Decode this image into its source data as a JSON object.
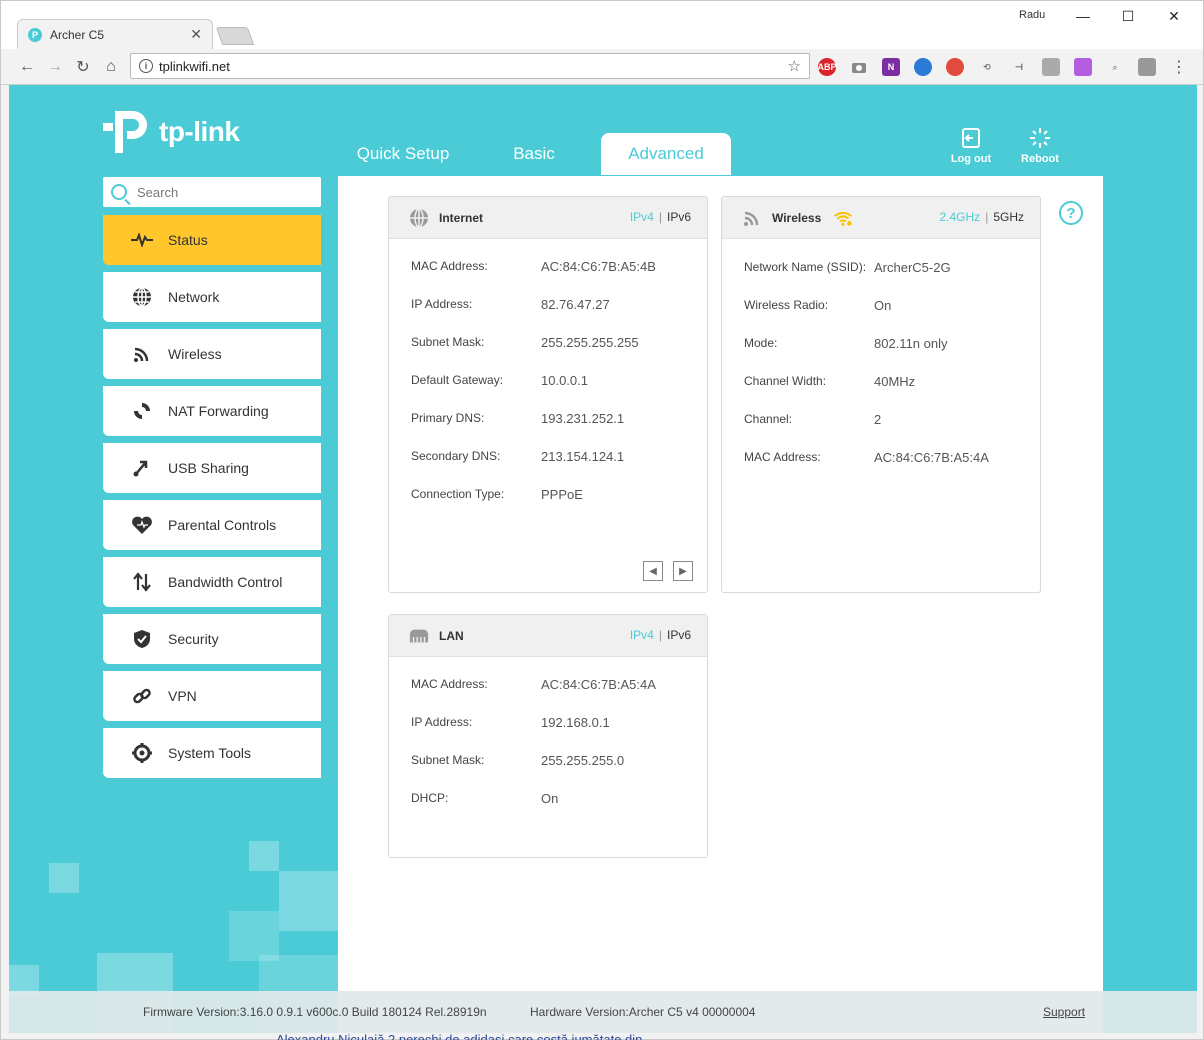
{
  "browser": {
    "tab_title": "Archer C5",
    "user": "Radu",
    "url": "tplinkwifi.net",
    "window_buttons": {
      "minimize": "—",
      "maximize": "☐",
      "close": "✕"
    }
  },
  "colors": {
    "brand": "#4acbd6",
    "active_menu": "#ffc72c",
    "wifi_icon": "#f5c400"
  },
  "logo": {
    "brand": "tp-link"
  },
  "topnav": {
    "quick_setup": "Quick Setup",
    "basic": "Basic",
    "advanced": "Advanced",
    "active": "advanced"
  },
  "tools": {
    "logout": "Log out",
    "reboot": "Reboot"
  },
  "search": {
    "placeholder": "Search"
  },
  "menu": [
    {
      "label": "Status",
      "icon": "pulse-icon",
      "active": true
    },
    {
      "label": "Network",
      "icon": "globe-icon"
    },
    {
      "label": "Wireless",
      "icon": "wifi-icon"
    },
    {
      "label": "NAT Forwarding",
      "icon": "nat-icon"
    },
    {
      "label": "USB Sharing",
      "icon": "usb-icon"
    },
    {
      "label": "Parental Controls",
      "icon": "heart-icon"
    },
    {
      "label": "Bandwidth Control",
      "icon": "arrows-icon"
    },
    {
      "label": "Security",
      "icon": "shield-icon"
    },
    {
      "label": "VPN",
      "icon": "link-icon"
    },
    {
      "label": "System Tools",
      "icon": "gear-icon"
    }
  ],
  "internet": {
    "title": "Internet",
    "switch": {
      "a": "IPv4",
      "b": "IPv6"
    },
    "rows": [
      {
        "label": "MAC Address:",
        "value": "AC:84:C6:7B:A5:4B"
      },
      {
        "label": "IP Address:",
        "value": "82.76.47.27"
      },
      {
        "label": "Subnet Mask:",
        "value": "255.255.255.255"
      },
      {
        "label": "Default Gateway:",
        "value": "10.0.0.1"
      },
      {
        "label": "Primary DNS:",
        "value": "193.231.252.1"
      },
      {
        "label": "Secondary DNS:",
        "value": "213.154.124.1"
      },
      {
        "label": "Connection Type:",
        "value": "PPPoE"
      }
    ]
  },
  "wireless": {
    "title": "Wireless",
    "switch": {
      "a": "2.4GHz",
      "b": "5GHz"
    },
    "rows": [
      {
        "label": "Network Name (SSID):",
        "value": "ArcherC5-2G"
      },
      {
        "label": "Wireless Radio:",
        "value": "On"
      },
      {
        "label": "Mode:",
        "value": "802.11n only"
      },
      {
        "label": "Channel Width:",
        "value": "40MHz"
      },
      {
        "label": "Channel:",
        "value": "2"
      },
      {
        "label": "MAC Address:",
        "value": "AC:84:C6:7B:A5:4A"
      }
    ]
  },
  "lan": {
    "title": "LAN",
    "switch": {
      "a": "IPv4",
      "b": "IPv6"
    },
    "rows": [
      {
        "label": "MAC Address:",
        "value": "AC:84:C6:7B:A5:4A"
      },
      {
        "label": "IP Address:",
        "value": "192.168.0.1"
      },
      {
        "label": "Subnet Mask:",
        "value": "255.255.255.0"
      },
      {
        "label": "DHCP:",
        "value": "On"
      }
    ]
  },
  "help": "?",
  "footer": {
    "firmware": "Firmware Version:3.16.0 0.9.1 v600c.0 Build 180124 Rel.28919n",
    "hardware": "Hardware Version:Archer C5 v4 00000004",
    "support": "Support"
  },
  "behind_text": "Alexandru Niculaiă 2 perechi de adidași care costă jumătate din"
}
